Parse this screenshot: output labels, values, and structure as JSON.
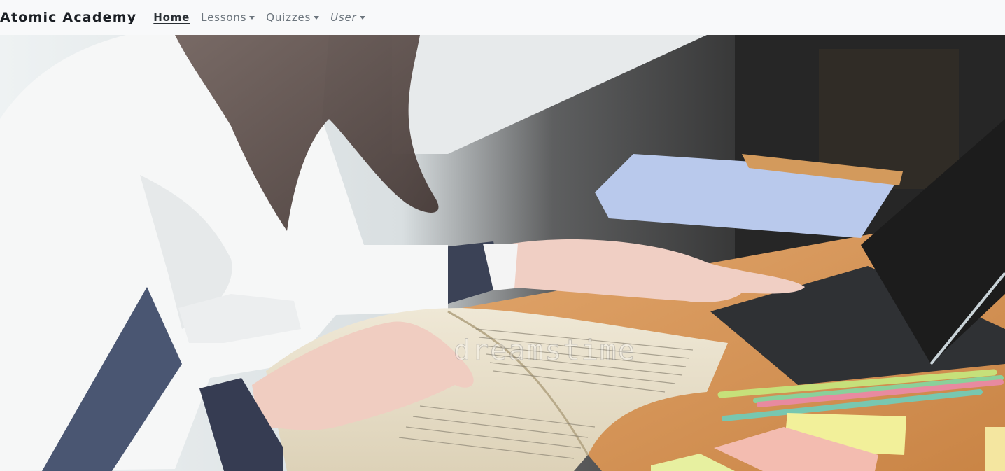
{
  "navbar": {
    "brand": "Atomic Academy",
    "links": [
      {
        "label": "Home",
        "active": true,
        "dropdown": false
      },
      {
        "label": "Lessons",
        "active": false,
        "dropdown": true
      },
      {
        "label": "Quizzes",
        "active": false,
        "dropdown": true
      },
      {
        "label": "User",
        "active": false,
        "dropdown": true
      }
    ]
  },
  "hero": {
    "image": "student studying with book and laptop",
    "watermark": "dreamstime"
  },
  "colors": {
    "navbar_bg": "#f8f9fa",
    "link": "#6c757d",
    "link_active": "#2a2f34"
  }
}
